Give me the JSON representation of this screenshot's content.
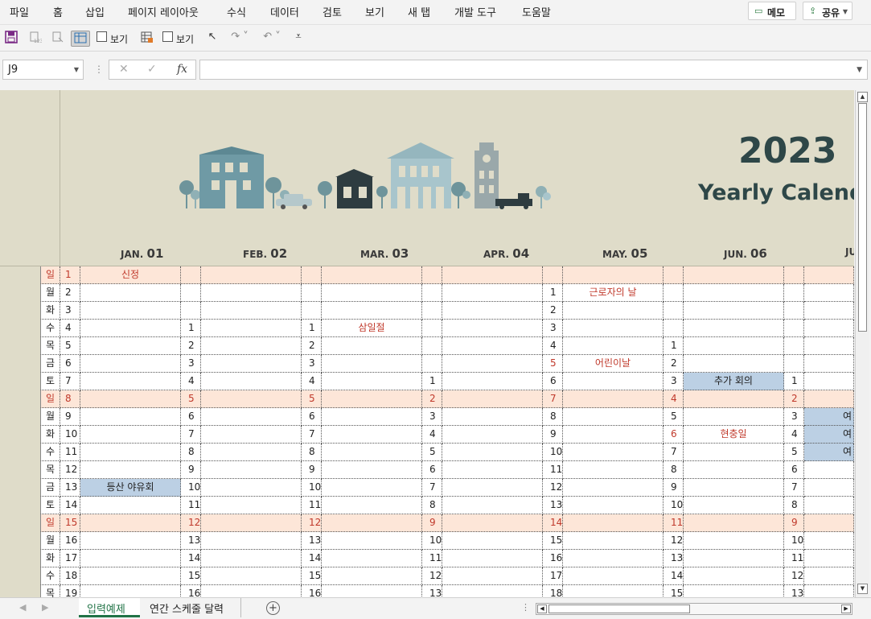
{
  "menu": [
    "파일",
    "홈",
    "삽입",
    "페이지 레이아웃",
    "수식",
    "데이터",
    "검토",
    "보기",
    "새 탭",
    "개발 도구",
    "도움말"
  ],
  "memo_label": "메모",
  "share_label": "공유",
  "qat": {
    "view1": "보기",
    "view2": "보기"
  },
  "namebox": "J9",
  "formula": "",
  "banner": {
    "year": "2023",
    "title": "Yearly Calenda"
  },
  "months": [
    {
      "abbr": "JAN.",
      "num": "01"
    },
    {
      "abbr": "FEB.",
      "num": "02"
    },
    {
      "abbr": "MAR.",
      "num": "03"
    },
    {
      "abbr": "APR.",
      "num": "04"
    },
    {
      "abbr": "MAY.",
      "num": "05"
    },
    {
      "abbr": "JUN.",
      "num": "06"
    },
    {
      "abbr": "JU",
      "num": ""
    }
  ],
  "grid_rows": [
    {
      "wd": "일",
      "d": "1",
      "sun": true,
      "c": [
        [
          "",
          "신정"
        ],
        [
          "",
          ""
        ],
        [
          "",
          ""
        ],
        [
          "",
          ""
        ],
        [
          "",
          ""
        ],
        [
          "",
          ""
        ],
        [
          "",
          ""
        ]
      ]
    },
    {
      "wd": "월",
      "d": "2",
      "c": [
        [
          "",
          ""
        ],
        [
          "",
          ""
        ],
        [
          "",
          ""
        ],
        [
          "",
          ""
        ],
        [
          "1",
          "근로자의 날"
        ],
        [
          "",
          ""
        ],
        [
          "",
          ""
        ]
      ]
    },
    {
      "wd": "화",
      "d": "3",
      "c": [
        [
          "",
          ""
        ],
        [
          "",
          ""
        ],
        [
          "",
          ""
        ],
        [
          "",
          ""
        ],
        [
          "2",
          ""
        ],
        [
          "",
          ""
        ],
        [
          "",
          ""
        ]
      ]
    },
    {
      "wd": "수",
      "d": "4",
      "c": [
        [
          "",
          ""
        ],
        [
          "1",
          ""
        ],
        [
          "1",
          "삼일절"
        ],
        [
          "",
          ""
        ],
        [
          "3",
          ""
        ],
        [
          "",
          ""
        ],
        [
          "",
          ""
        ]
      ]
    },
    {
      "wd": "목",
      "d": "5",
      "c": [
        [
          "",
          ""
        ],
        [
          "2",
          ""
        ],
        [
          "2",
          ""
        ],
        [
          "",
          ""
        ],
        [
          "4",
          ""
        ],
        [
          "1",
          ""
        ],
        [
          "",
          ""
        ]
      ]
    },
    {
      "wd": "금",
      "d": "6",
      "c": [
        [
          "",
          ""
        ],
        [
          "3",
          ""
        ],
        [
          "3",
          ""
        ],
        [
          "",
          ""
        ],
        [
          "5",
          "어린이날"
        ],
        [
          "2",
          ""
        ],
        [
          "",
          ""
        ]
      ]
    },
    {
      "wd": "토",
      "d": "7",
      "c": [
        [
          "",
          ""
        ],
        [
          "4",
          ""
        ],
        [
          "4",
          ""
        ],
        [
          "1",
          ""
        ],
        [
          "6",
          ""
        ],
        [
          "3",
          "추가 회의"
        ],
        [
          "1",
          ""
        ]
      ]
    },
    {
      "wd": "일",
      "d": "8",
      "sun": true,
      "c": [
        [
          "",
          ""
        ],
        [
          "5",
          ""
        ],
        [
          "5",
          ""
        ],
        [
          "2",
          ""
        ],
        [
          "7",
          ""
        ],
        [
          "4",
          ""
        ],
        [
          "2",
          ""
        ]
      ]
    },
    {
      "wd": "월",
      "d": "9",
      "c": [
        [
          "",
          ""
        ],
        [
          "6",
          ""
        ],
        [
          "6",
          ""
        ],
        [
          "3",
          ""
        ],
        [
          "8",
          ""
        ],
        [
          "5",
          ""
        ],
        [
          "3",
          "여"
        ]
      ]
    },
    {
      "wd": "화",
      "d": "10",
      "c": [
        [
          "",
          ""
        ],
        [
          "7",
          ""
        ],
        [
          "7",
          ""
        ],
        [
          "4",
          ""
        ],
        [
          "9",
          ""
        ],
        [
          "6",
          "현충일"
        ],
        [
          "4",
          "여"
        ]
      ]
    },
    {
      "wd": "수",
      "d": "11",
      "c": [
        [
          "",
          ""
        ],
        [
          "8",
          ""
        ],
        [
          "8",
          ""
        ],
        [
          "5",
          ""
        ],
        [
          "10",
          ""
        ],
        [
          "7",
          ""
        ],
        [
          "5",
          "여"
        ]
      ]
    },
    {
      "wd": "목",
      "d": "12",
      "c": [
        [
          "",
          ""
        ],
        [
          "9",
          ""
        ],
        [
          "9",
          ""
        ],
        [
          "6",
          ""
        ],
        [
          "11",
          ""
        ],
        [
          "8",
          ""
        ],
        [
          "6",
          ""
        ]
      ]
    },
    {
      "wd": "금",
      "d": "13",
      "c": [
        [
          "",
          "등산 야유회"
        ],
        [
          "10",
          ""
        ],
        [
          "10",
          ""
        ],
        [
          "7",
          ""
        ],
        [
          "12",
          ""
        ],
        [
          "9",
          ""
        ],
        [
          "7",
          ""
        ]
      ]
    },
    {
      "wd": "토",
      "d": "14",
      "c": [
        [
          "",
          ""
        ],
        [
          "11",
          ""
        ],
        [
          "11",
          ""
        ],
        [
          "8",
          ""
        ],
        [
          "13",
          ""
        ],
        [
          "10",
          ""
        ],
        [
          "8",
          ""
        ]
      ]
    },
    {
      "wd": "일",
      "d": "15",
      "sun": true,
      "c": [
        [
          "",
          ""
        ],
        [
          "12",
          ""
        ],
        [
          "12",
          ""
        ],
        [
          "9",
          ""
        ],
        [
          "14",
          ""
        ],
        [
          "11",
          ""
        ],
        [
          "9",
          ""
        ]
      ]
    },
    {
      "wd": "월",
      "d": "16",
      "c": [
        [
          "",
          ""
        ],
        [
          "13",
          ""
        ],
        [
          "13",
          ""
        ],
        [
          "10",
          ""
        ],
        [
          "15",
          ""
        ],
        [
          "12",
          ""
        ],
        [
          "10",
          ""
        ]
      ]
    },
    {
      "wd": "화",
      "d": "17",
      "c": [
        [
          "",
          ""
        ],
        [
          "14",
          ""
        ],
        [
          "14",
          ""
        ],
        [
          "11",
          ""
        ],
        [
          "16",
          ""
        ],
        [
          "13",
          ""
        ],
        [
          "11",
          ""
        ]
      ]
    },
    {
      "wd": "수",
      "d": "18",
      "c": [
        [
          "",
          ""
        ],
        [
          "15",
          ""
        ],
        [
          "15",
          ""
        ],
        [
          "12",
          ""
        ],
        [
          "17",
          ""
        ],
        [
          "14",
          ""
        ],
        [
          "12",
          ""
        ]
      ]
    },
    {
      "wd": "목",
      "d": "19",
      "c": [
        [
          "",
          ""
        ],
        [
          "16",
          ""
        ],
        [
          "16",
          ""
        ],
        [
          "13",
          ""
        ],
        [
          "18",
          ""
        ],
        [
          "15",
          ""
        ],
        [
          "13",
          ""
        ]
      ]
    }
  ],
  "sheet_tabs": [
    "입력예제",
    "연간 스케줄 달력"
  ],
  "colors": {
    "accent": "#217346",
    "banner_bg": "#dfdcc9",
    "title": "#2e4748",
    "sunday_bg": "#fde6d8",
    "holiday_red": "#c0392b",
    "event_blue": "#bcd0e4"
  }
}
